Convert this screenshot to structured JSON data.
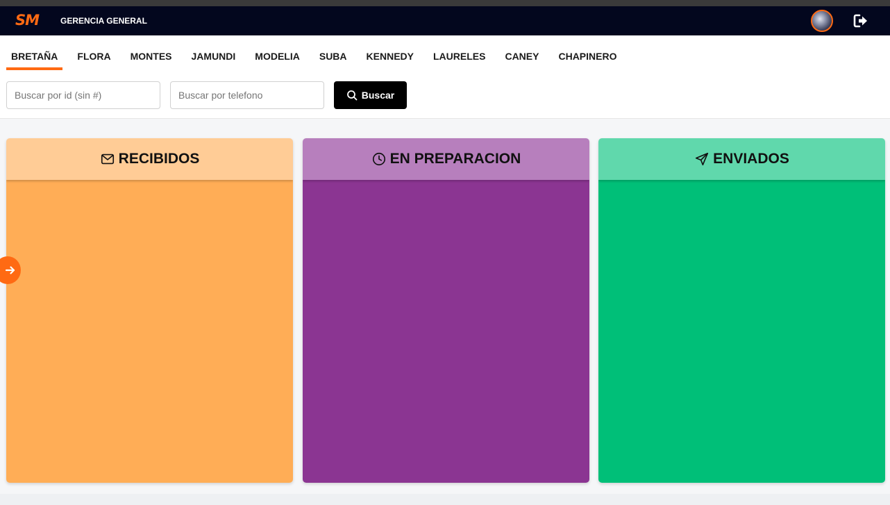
{
  "navbar": {
    "logo": "SM",
    "role": "GERENCIA GENERAL",
    "icons": {
      "avatar": "user-avatar",
      "logout": "logout-icon"
    }
  },
  "tabs": [
    {
      "label": "BRETAÑA",
      "active": true
    },
    {
      "label": "FLORA",
      "active": false
    },
    {
      "label": "MONTES",
      "active": false
    },
    {
      "label": "JAMUNDI",
      "active": false
    },
    {
      "label": "MODELIA",
      "active": false
    },
    {
      "label": "SUBA",
      "active": false
    },
    {
      "label": "KENNEDY",
      "active": false
    },
    {
      "label": "LAURELES",
      "active": false
    },
    {
      "label": "CANEY",
      "active": false
    },
    {
      "label": "CHAPINERO",
      "active": false
    }
  ],
  "search": {
    "id_placeholder": "Buscar por id (sin #)",
    "id_value": "",
    "phone_placeholder": "Buscar por telefono",
    "phone_value": "",
    "button_label": "Buscar"
  },
  "columns": {
    "received": {
      "title": "RECIBIDOS",
      "icon": "mail-icon",
      "header_color": "#ffcc96",
      "body_color": "#ffad56"
    },
    "preparing": {
      "title": "EN PREPARACION",
      "icon": "clock-icon",
      "header_color": "#b77fbd",
      "body_color": "#8b3592"
    },
    "sent": {
      "title": "ENVIADOS",
      "icon": "send-icon",
      "header_color": "#60d8ac",
      "body_color": "#00bf78"
    }
  },
  "colors": {
    "accent": "#ff6a13",
    "navbar": "#03071e"
  }
}
